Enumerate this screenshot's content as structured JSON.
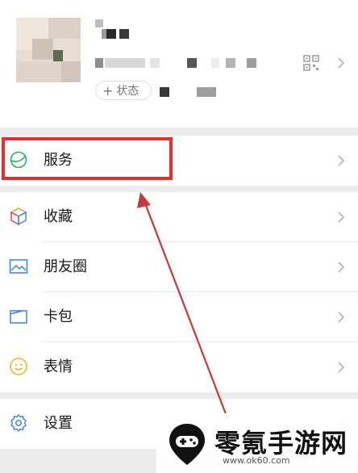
{
  "profile": {
    "status_label": "状态"
  },
  "menu": {
    "services": "服务",
    "favorites": "收藏",
    "moments": "朋友圈",
    "cards": "卡包",
    "stickers": "表情",
    "settings": "设置"
  },
  "watermark": {
    "brand": "零氪手游网",
    "url": "www.ok60.com"
  },
  "colors": {
    "highlight": "#e03030",
    "accent": "#07c160"
  }
}
